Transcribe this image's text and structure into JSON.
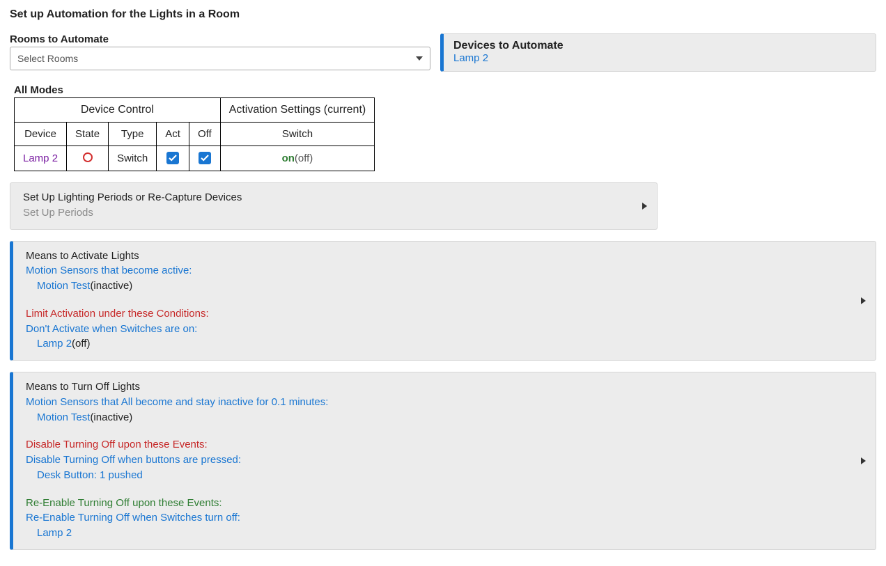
{
  "page_title": "Set up Automation for the Lights in a Room",
  "rooms": {
    "label": "Rooms to Automate",
    "placeholder": "Select Rooms"
  },
  "devices_box": {
    "title": "Devices to Automate",
    "device": "Lamp 2"
  },
  "all_modes_label": "All Modes",
  "table": {
    "group1": "Device Control",
    "group2": "Activation Settings (current)",
    "h_device": "Device",
    "h_state": "State",
    "h_type": "Type",
    "h_act": "Act",
    "h_off": "Off",
    "h_switch": "Switch",
    "row": {
      "device": "Lamp 2",
      "type": "Switch",
      "on": "on",
      "off": "(off)"
    }
  },
  "setup_card": {
    "title": "Set Up Lighting Periods or Re-Capture Devices",
    "sub": "Set Up Periods"
  },
  "activate_card": {
    "title": "Means to Activate Lights",
    "motion_label": "Motion Sensors that become active:",
    "motion_sensor": "Motion Test",
    "motion_state": "(inactive)",
    "limit_label": "Limit Activation under these Conditions:",
    "dont_label": "Don't Activate when Switches are on:",
    "dont_item": "Lamp 2",
    "dont_state": "(off)"
  },
  "off_card": {
    "title": "Means to Turn Off Lights",
    "motion_label": "Motion Sensors that All become and stay inactive for 0.1 minutes:",
    "motion_sensor": "Motion Test",
    "motion_state": "(inactive)",
    "disable_label": "Disable Turning Off upon these Events:",
    "disable_sub": "Disable Turning Off when buttons are pressed:",
    "disable_item": "Desk Button: 1 pushed",
    "reenable_label": "Re-Enable Turning Off upon these Events:",
    "reenable_sub": "Re-Enable Turning Off when Switches turn off:",
    "reenable_item": "Lamp 2"
  }
}
